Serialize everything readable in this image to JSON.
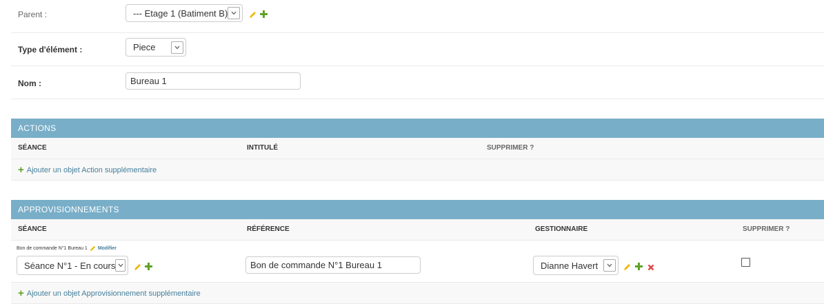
{
  "form": {
    "parent_label": "Parent :",
    "parent_value": "--- Etage 1 (Batiment B)",
    "type_label": "Type d'élément :",
    "type_value": "Piece",
    "nom_label": "Nom :",
    "nom_value": "Bureau 1"
  },
  "actions": {
    "title": "ACTIONS",
    "columns": [
      "SÉANCE",
      "INTITULÉ",
      "SUPPRIMER ?"
    ],
    "add_label": "Ajouter un objet Action supplémentaire"
  },
  "approvisionnements": {
    "title": "APPROVISIONNEMENTS",
    "columns": [
      "SÉANCE",
      "RÉFÉRENCE",
      "GESTIONNAIRE",
      "SUPPRIMER ?"
    ],
    "row": {
      "caption": "Bon de commande N°1 Bureau 1",
      "modify_label": "Modifier",
      "seance": "Séance N°1 - En cours",
      "reference": "Bon de commande N°1 Bureau 1",
      "gestionnaire": "Dianne Havert",
      "delete_checked": false
    },
    "add_label": "Ajouter un objet Approvisionnement supplémentaire"
  },
  "colors": {
    "header_bg": "#79aec8",
    "link": "#447e9b",
    "add_icon": "#5fa225",
    "edit_icon": "#efb80b",
    "delete_icon": "#dd4646"
  },
  "icons": [
    "chevron-down-icon",
    "pencil-icon",
    "plus-icon",
    "delete-x-icon"
  ]
}
